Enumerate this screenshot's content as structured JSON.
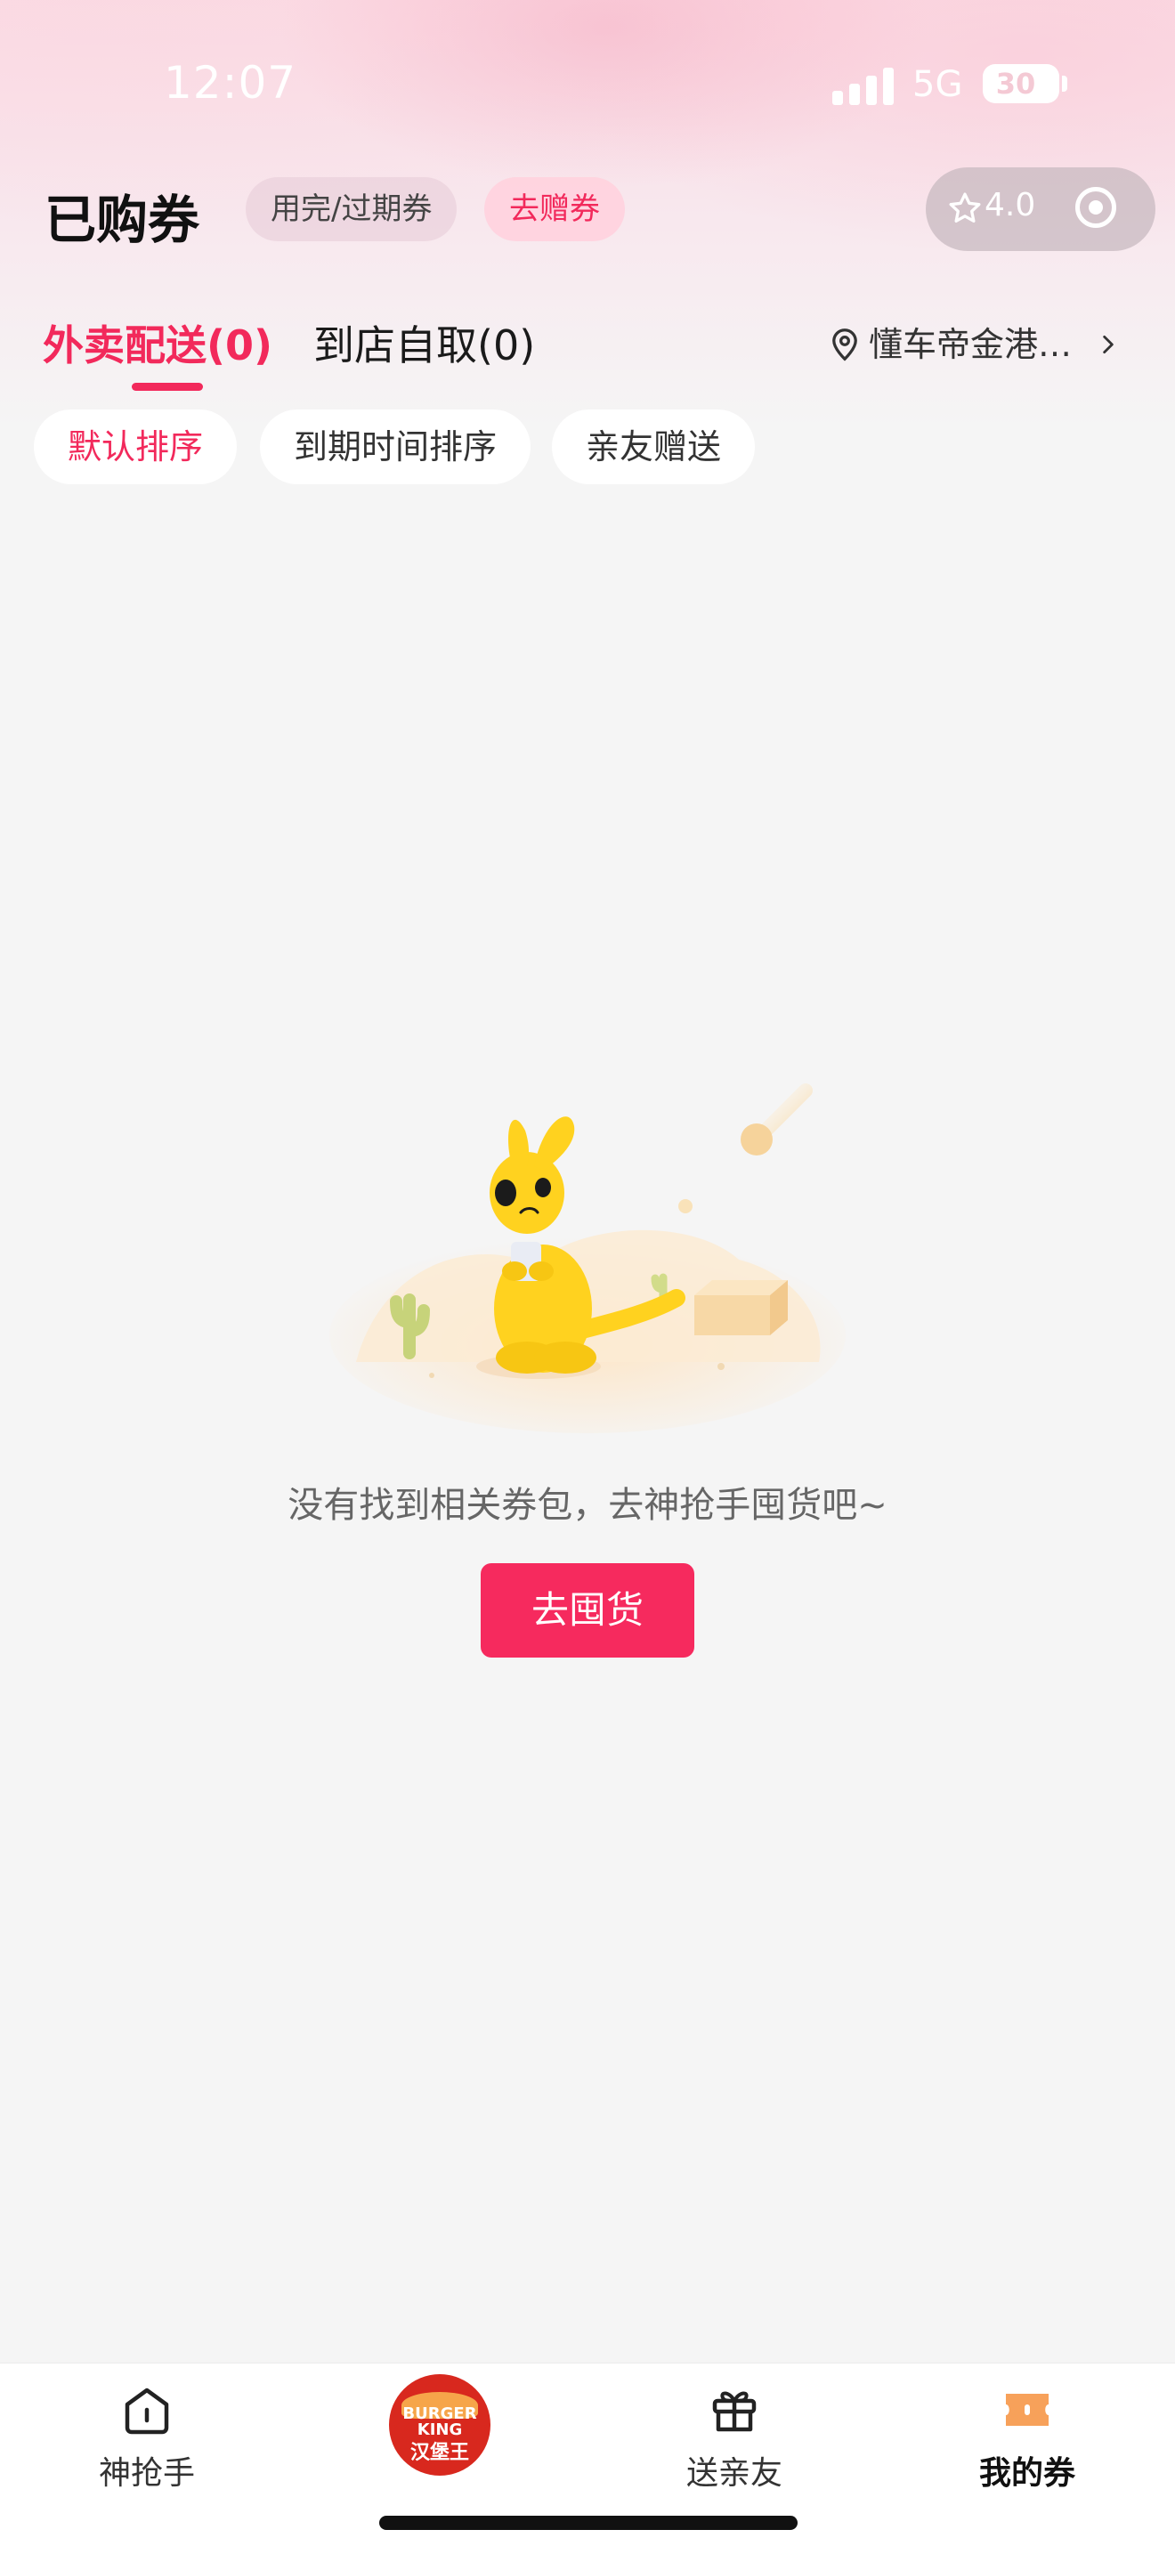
{
  "status_bar": {
    "time": "12:07",
    "network": "5G",
    "battery": "30"
  },
  "header": {
    "title": "已购券",
    "expired_chip": "用完/过期券",
    "gift_chip": "去赠券",
    "rating": "4.0"
  },
  "tabs": {
    "delivery": "外卖配送(0)",
    "pickup": "到店自取(0)",
    "location": "懂车帝金港汽…"
  },
  "sort": {
    "default": "默认排序",
    "expiry": "到期时间排序",
    "gift": "亲友赠送"
  },
  "empty": {
    "message": "没有找到相关券包，去神抢手囤货吧~",
    "cta": "去囤货"
  },
  "nav": {
    "home": "神抢手",
    "brand_logo_text": [
      "BURGER",
      "KING",
      "汉堡王"
    ],
    "gift": "送亲友",
    "mine": "我的券"
  },
  "colors": {
    "accent": "#f2295b",
    "cta": "#f62a5e",
    "mascot": "#ffd21f"
  }
}
